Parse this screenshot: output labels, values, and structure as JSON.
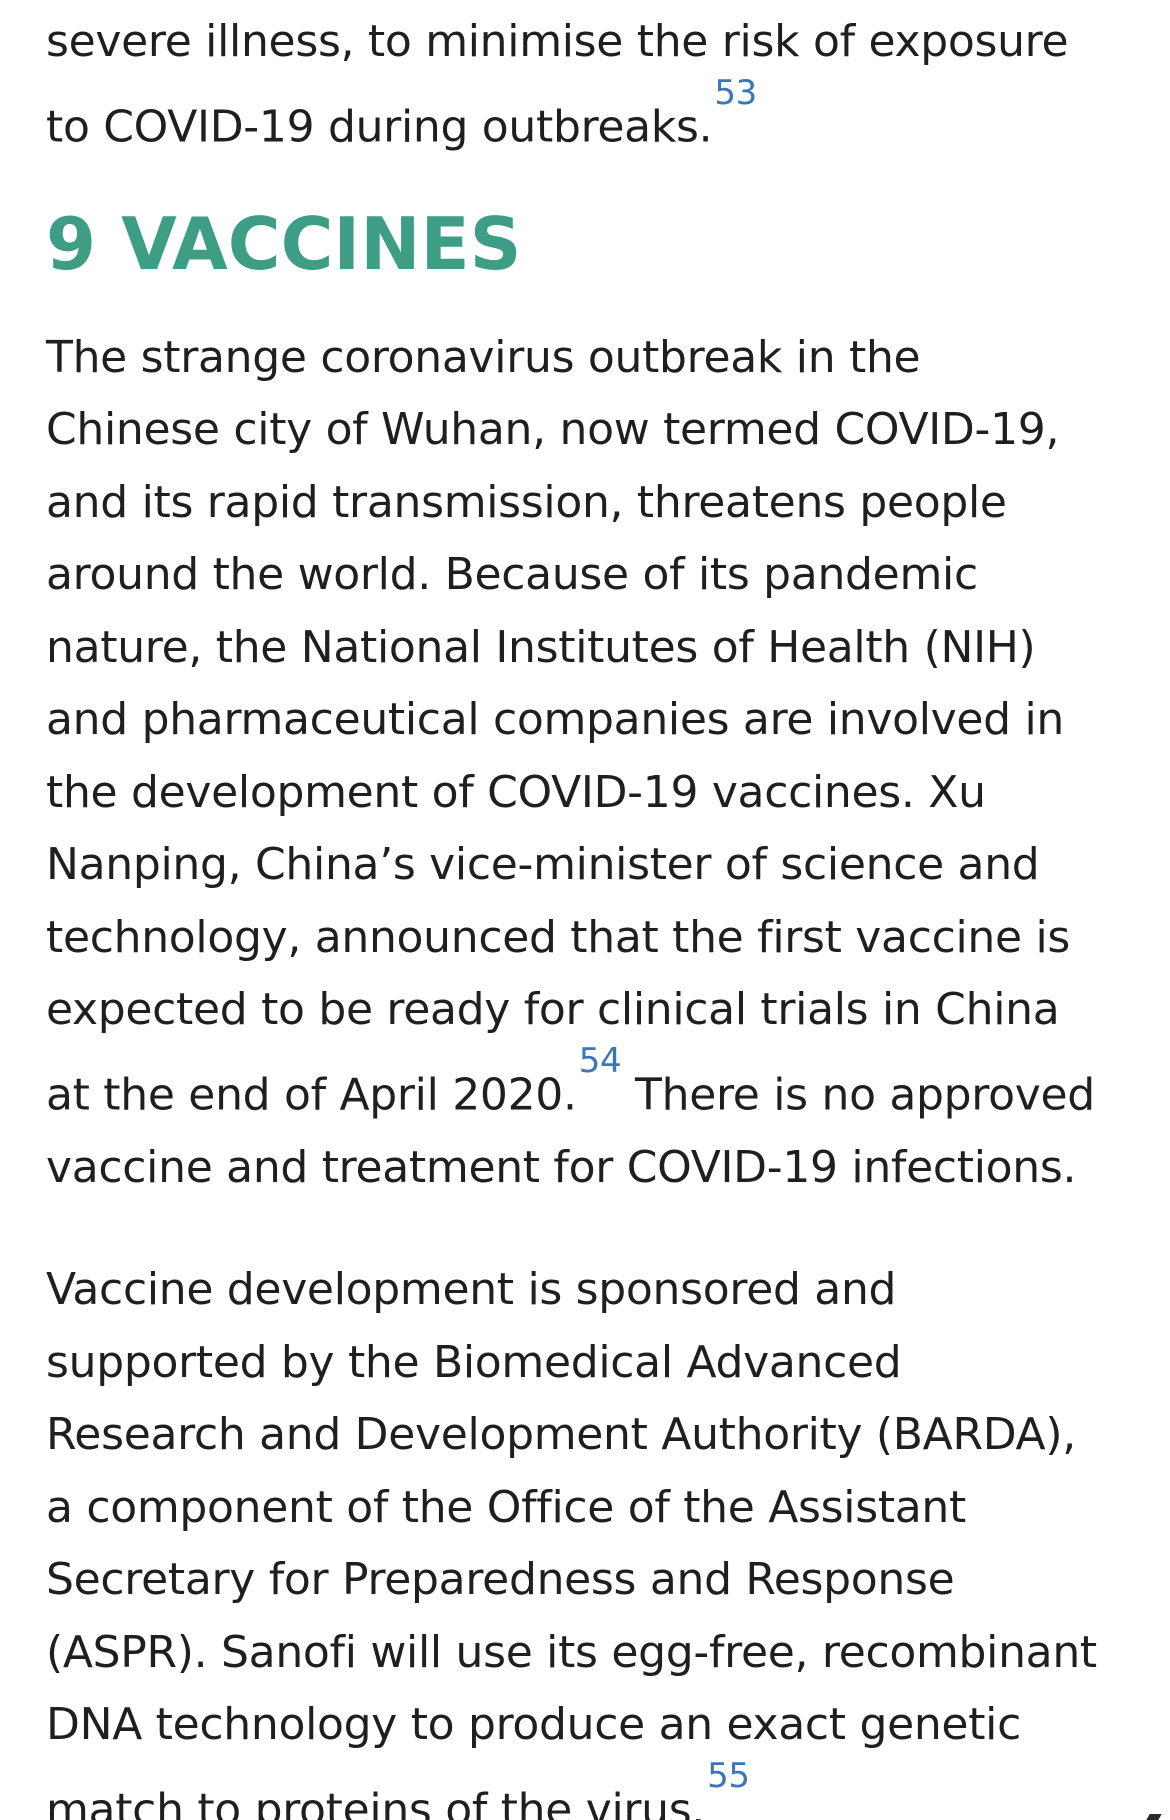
{
  "intro_paragraph": {
    "lines": [
      "severe illness, to minimise the risk of exposure",
      "to COVID-19 during outbreaks."
    ],
    "ref": "53"
  },
  "section": {
    "heading": "9 VACCINES"
  },
  "paragraph_1": {
    "lines": [
      "The strange coronavirus outbreak in the",
      "Chinese city of Wuhan, now termed COVID-19,",
      "and its rapid transmission, threatens people",
      "around the world. Because of its pandemic",
      "nature, the National Institutes of Health (NIH)",
      "and pharmaceutical companies are involved in",
      "the development of COVID-19 vaccines. Xu",
      "Nanping, China’s vice-minister of science and",
      "technology, announced that the first vaccine is",
      "expected to be ready for clinical trials in China",
      "at the end of April 2020."
    ],
    "ref": "54",
    "line_after_ref": " There is no approved",
    "last_line": "vaccine and treatment for COVID-19 infections."
  },
  "paragraph_2": {
    "lines": [
      "Vaccine development is sponsored and",
      "supported by the Biomedical Advanced",
      "Research and Development Authority (BARDA),",
      "a component of the Office of the Assistant",
      "Secretary for Preparedness and Response",
      "(ASPR). Sanofi will use its egg-free, recombinant",
      "DNA technology to produce an exact genetic",
      "match to proteins of the virus."
    ],
    "ref": "55"
  },
  "colors": {
    "heading": "#3d9e85",
    "reference_link": "#3a78b5",
    "body_text": "#1f1f1f"
  }
}
